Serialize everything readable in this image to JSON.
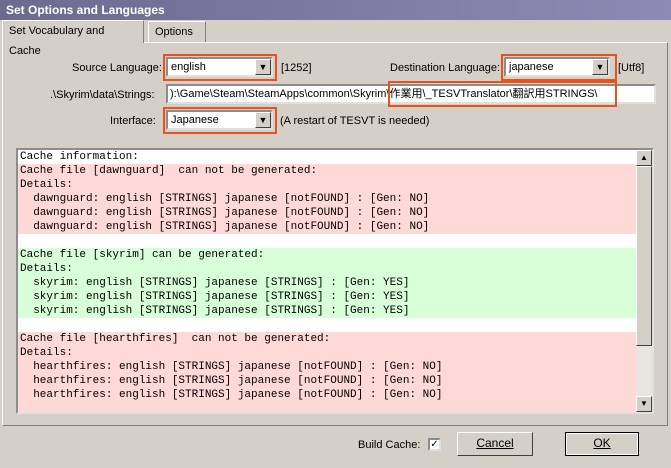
{
  "window": {
    "title": "Set Options and Languages"
  },
  "tabs": [
    {
      "label": "Set Vocabulary and Cache"
    },
    {
      "label": "Options"
    }
  ],
  "form": {
    "source_language_label": "Source Language:",
    "source_language_value": "english",
    "source_codepage": "[1252]",
    "destination_language_label": "Destination Language:",
    "destination_language_value": "japanese",
    "destination_codepage": "[Utf8]",
    "strings_label": ".\\Skyrim\\data\\Strings:",
    "strings_path": "):\\Game\\Steam\\SteamApps\\common\\Skyrim\\作業用\\_TESVTranslator\\翻訳用STRINGS\\",
    "interface_label": "Interface:",
    "interface_value": "Japanese",
    "interface_note": "(A restart of TESVT is needed)"
  },
  "log": {
    "lines": [
      {
        "text": "Cache information:",
        "style": "white"
      },
      {
        "text": "Cache file [dawnguard]  can not be generated:",
        "style": "red"
      },
      {
        "text": "Details:",
        "style": "red"
      },
      {
        "text": "  dawnguard: english [STRINGS] japanese [notFOUND] : [Gen: NO]",
        "style": "red"
      },
      {
        "text": "  dawnguard: english [STRINGS] japanese [notFOUND] : [Gen: NO]",
        "style": "red"
      },
      {
        "text": "  dawnguard: english [STRINGS] japanese [notFOUND] : [Gen: NO]",
        "style": "red"
      },
      {
        "text": "",
        "style": "white"
      },
      {
        "text": "Cache file [skyrim] can be generated:",
        "style": "green"
      },
      {
        "text": "Details:",
        "style": "green"
      },
      {
        "text": "  skyrim: english [STRINGS] japanese [STRINGS] : [Gen: YES]",
        "style": "green"
      },
      {
        "text": "  skyrim: english [STRINGS] japanese [STRINGS] : [Gen: YES]",
        "style": "green"
      },
      {
        "text": "  skyrim: english [STRINGS] japanese [STRINGS] : [Gen: YES]",
        "style": "green"
      },
      {
        "text": "",
        "style": "white"
      },
      {
        "text": "Cache file [hearthfires]  can not be generated:",
        "style": "red"
      },
      {
        "text": "Details:",
        "style": "red"
      },
      {
        "text": "  hearthfires: english [STRINGS] japanese [notFOUND] : [Gen: NO]",
        "style": "red"
      },
      {
        "text": "  hearthfires: english [STRINGS] japanese [notFOUND] : [Gen: NO]",
        "style": "red"
      },
      {
        "text": "  hearthfires: english [STRINGS] japanese [notFOUND] : [Gen: NO]",
        "style": "red"
      },
      {
        "text": "",
        "style": "red"
      }
    ]
  },
  "footer": {
    "build_cache_label": "Build Cache:",
    "build_cache_checked": "✓",
    "cancel_label": "Cancel",
    "ok_label": "OK"
  },
  "colors": {
    "highlight": "#e8531b",
    "error_bg": "#ffd8d8",
    "ok_bg": "#d8ffd8"
  }
}
